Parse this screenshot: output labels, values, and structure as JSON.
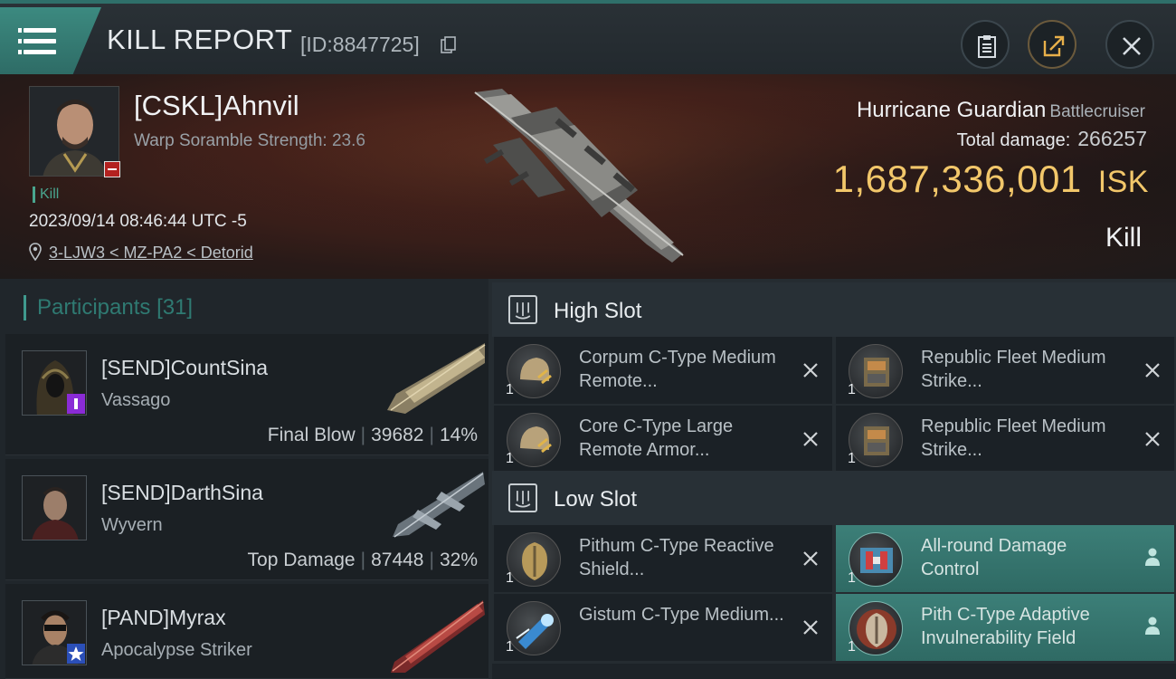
{
  "header": {
    "title": "KILL REPORT",
    "report_id": "[ID:8847725]"
  },
  "victim": {
    "name": "[CSKL]Ahnvil",
    "warp_scramble": "Warp Soramble Strength: 23.6",
    "tag": "Kill",
    "datetime": "2023/09/14 08:46:44 UTC -5",
    "location": "3-LJW3 < MZ-PA2 < Detorid",
    "ship_name": "Hurricane Guardian",
    "ship_class": "Battlecruiser",
    "total_damage_label": "Total damage:",
    "total_damage": "266257",
    "isk_value": "1,687,336,001",
    "isk_unit": "ISK",
    "result": "Kill"
  },
  "participants": {
    "title": "Participants",
    "count": "[31]",
    "rows": [
      {
        "name": "[SEND]CountSina",
        "ship": "Vassago",
        "role": "Final Blow",
        "damage": "39682",
        "percent": "14%"
      },
      {
        "name": "[SEND]DarthSina",
        "ship": "Wyvern",
        "role": "Top Damage",
        "damage": "87448",
        "percent": "32%"
      },
      {
        "name": "[PAND]Myrax",
        "ship": "Apocalypse Striker",
        "role": "",
        "damage": "",
        "percent": ""
      }
    ]
  },
  "slots": {
    "high": {
      "label": "High Slot",
      "modules": [
        {
          "name": "Corpum C-Type Medium Remote...",
          "qty": "1"
        },
        {
          "name": "Republic Fleet Medium Strike...",
          "qty": "1"
        },
        {
          "name": "Core C-Type Large Remote Armor...",
          "qty": "1"
        },
        {
          "name": "Republic Fleet Medium Strike...",
          "qty": "1"
        }
      ]
    },
    "low": {
      "label": "Low Slot",
      "modules": [
        {
          "name": "Pithum C-Type Reactive Shield...",
          "qty": "1"
        },
        {
          "name": "All-round Damage Control",
          "qty": "1"
        },
        {
          "name": "Gistum C-Type Medium...",
          "qty": "1"
        },
        {
          "name": "Pith C-Type Adaptive Invulnerability Field",
          "qty": "1"
        }
      ]
    }
  },
  "colors": {
    "accent_teal": "#3c8a80",
    "isk_gold": "#f2c76a",
    "negative_red": "#b3211f"
  }
}
